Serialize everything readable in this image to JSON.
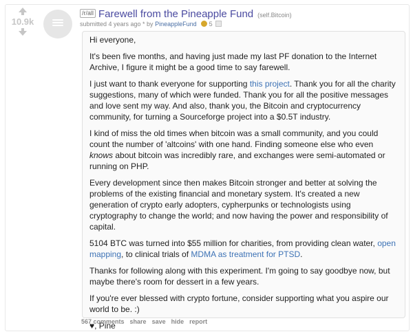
{
  "vote": {
    "score": "10.9k"
  },
  "post": {
    "subreddit_tag": "/r/all",
    "title": "Farewell from the Pineapple Fund",
    "domain": "(self.Bitcoin)",
    "tagline_prefix": "submitted 4 years ago * by",
    "author": "PineappleFund",
    "award_count": "5"
  },
  "body": {
    "greeting": "Hi everyone,",
    "p1": "It's been five months, and having just made my last PF donation to the Internet Archive, I figure it might be a good time to say farewell.",
    "p2_before": "I just want to thank everyone for supporting ",
    "p2_link": "this project",
    "p2_after": ". Thank you for all the charity suggestions, many of which were funded. Thank you for all the positive messages and love sent my way. And also, thank you, the Bitcoin and cryptocurrency community, for turning a Sourceforge project into a $0.5T industry.",
    "p3_before": "I kind of miss the old times when bitcoin was a small community, and you could count the number of 'altcoins' with one hand. Finding someone else who even ",
    "p3_em": "knows",
    "p3_after": " about bitcoin was incredibly rare, and exchanges were semi-automated or running on PHP.",
    "p4": "Every development since then makes Bitcoin stronger and better at solving the problems of the existing financial and monetary system. It's created a new generation of crypto early adopters, cypherpunks or technologists using cryptography to change the world; and now having the power and responsibility of capital.",
    "p5_before": "5104 BTC was turned into $55 million for charities, from providing clean water, ",
    "p5_link1": "open mapping",
    "p5_mid": ", to clinical trials of ",
    "p5_link2": "MDMA as treatment for PTSD",
    "p5_after": ".",
    "p6": "Thanks for following along with this experiment. I'm going to say goodbye now, but maybe there's room for dessert in a few years.",
    "p7": "If you're ever blessed with crypto fortune, consider supporting what you aspire our world to be. :)",
    "signoff": "♥, Pine"
  },
  "buttons": {
    "comments": "567 comments",
    "share": "share",
    "save": "save",
    "hide": "hide",
    "report": "report"
  },
  "colors": {
    "title": "#4a4aa0",
    "link": "#3d72b5",
    "muted": "#888888"
  }
}
